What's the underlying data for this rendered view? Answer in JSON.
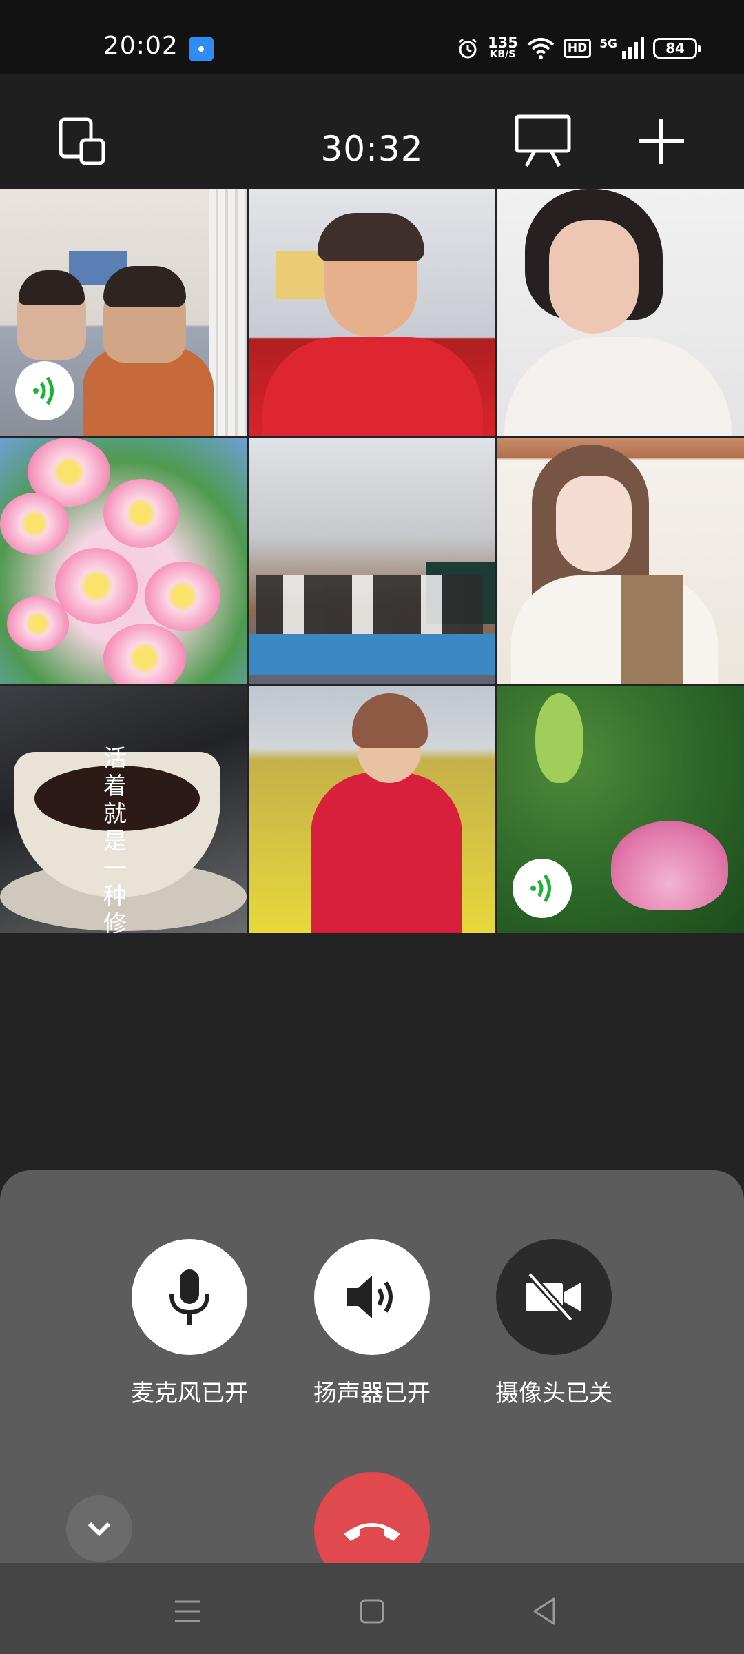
{
  "status_bar": {
    "time": "20:02",
    "net_speed_value": "135",
    "net_speed_unit": "KB/S",
    "hd_label": "HD",
    "network_label": "5G",
    "battery": "84"
  },
  "top_bar": {
    "call_duration": "30:32"
  },
  "participants": [
    {
      "tile": "participant-1",
      "speaking": true
    },
    {
      "tile": "participant-2",
      "speaking": false
    },
    {
      "tile": "participant-3",
      "speaking": false
    },
    {
      "tile": "participant-4",
      "speaking": false
    },
    {
      "tile": "participant-5",
      "speaking": false
    },
    {
      "tile": "participant-6",
      "speaking": false
    },
    {
      "tile": "participant-7",
      "speaking": false,
      "overlay_text": "活着就是一种修行。"
    },
    {
      "tile": "participant-8",
      "speaking": false
    },
    {
      "tile": "participant-9",
      "speaking": true
    }
  ],
  "controls": {
    "mic_label": "麦克风已开",
    "speaker_label": "扬声器已开",
    "camera_label": "摄像头已关"
  },
  "colors": {
    "hangup": "#e0494d",
    "speaking_indicator": "#1fb134",
    "sheet_bg": "#5c5c5c",
    "app_bg": "#232323"
  }
}
